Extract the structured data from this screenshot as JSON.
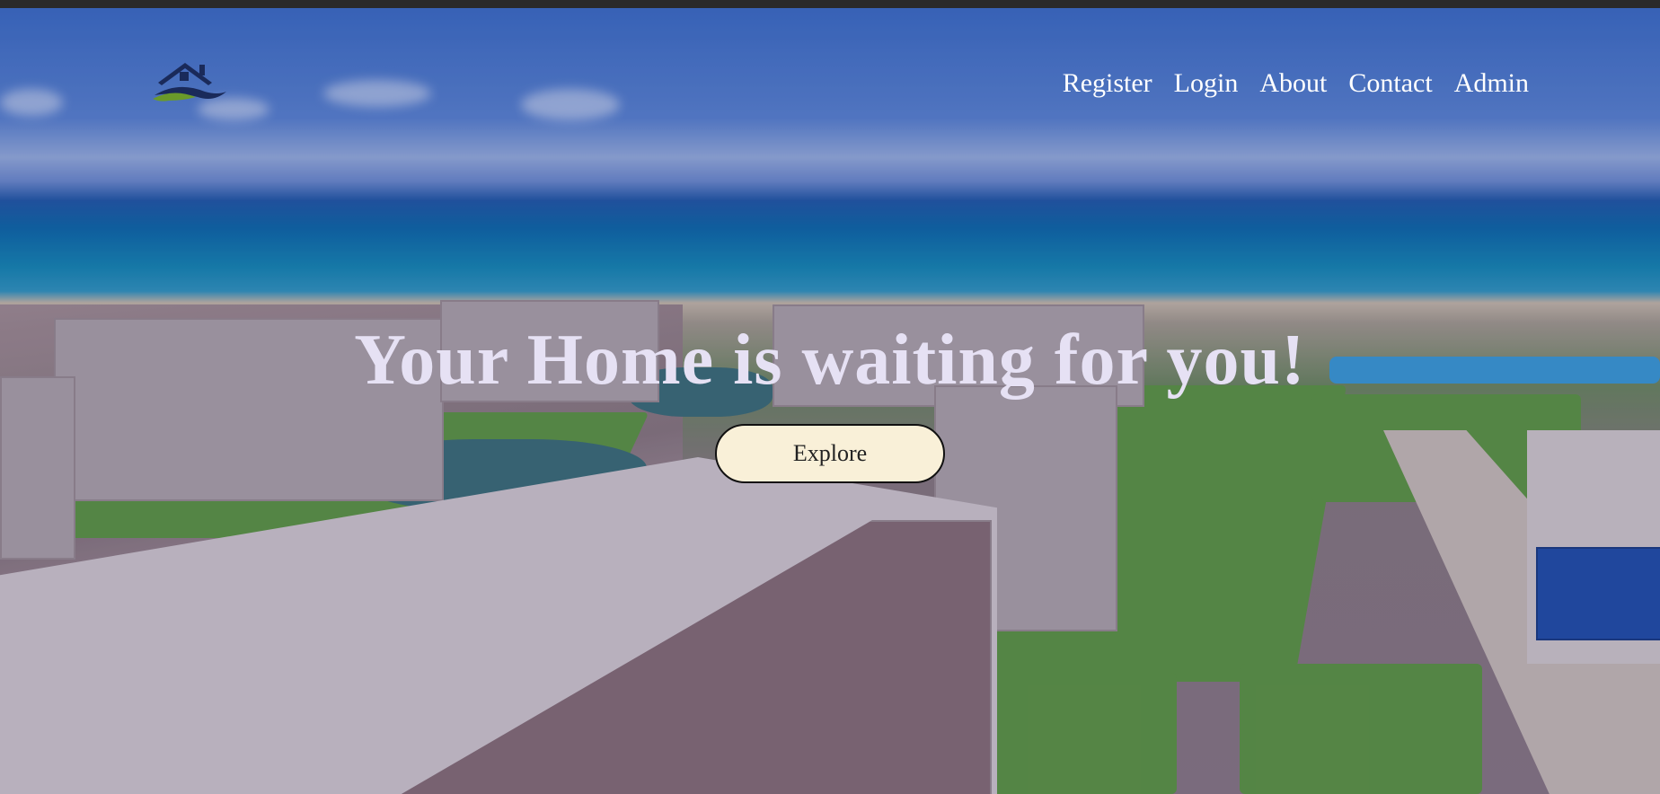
{
  "nav": {
    "items": [
      {
        "label": "Register"
      },
      {
        "label": "Login"
      },
      {
        "label": "About"
      },
      {
        "label": "Contact"
      },
      {
        "label": "Admin"
      }
    ]
  },
  "hero": {
    "headline": "Your Home is waiting for you!",
    "cta_label": "Explore"
  },
  "logo": {
    "icon": "house-logo-icon",
    "colors": {
      "roof": "#1a2a5a",
      "swoosh_green": "#6a9a2a",
      "swoosh_dark": "#1a2a5a"
    }
  },
  "colors": {
    "topbar": "#2a2a2a",
    "nav_text": "#ffffff",
    "headline_text": "#e6e1f4",
    "button_bg": "#f9f0d8",
    "button_border": "#111111"
  }
}
